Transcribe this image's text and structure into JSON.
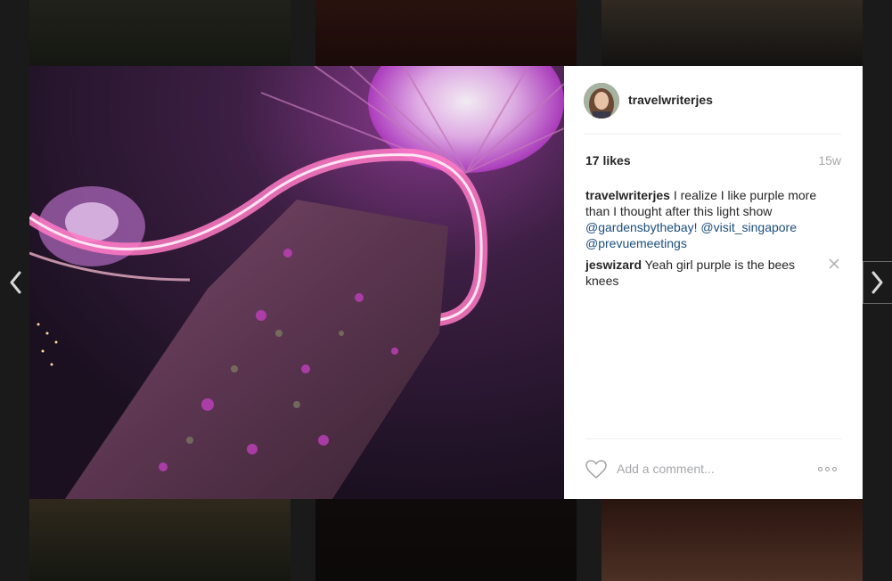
{
  "post": {
    "username": "travelwriterjes",
    "likes": "17 likes",
    "age": "15w",
    "caption": {
      "user": "travelwriterjes",
      "text": "I realize I like purple more than I thought after this light show",
      "mentions": [
        "@gardensbythebay!",
        "@visit_singapore",
        "@prevuemeetings"
      ]
    },
    "comments": [
      {
        "user": "jeswizard",
        "text": "Yeah girl purple is the bees knees"
      }
    ],
    "add_comment_placeholder": "Add a comment..."
  },
  "icons": {
    "prev": "chevron-left-icon",
    "next": "chevron-right-icon",
    "like": "heart-icon",
    "delete": "close-icon",
    "more": "more-options-icon"
  },
  "colors": {
    "accent_purple": "#c23bd6",
    "mention": "#1b4e7e",
    "muted": "#a5a7aa"
  }
}
